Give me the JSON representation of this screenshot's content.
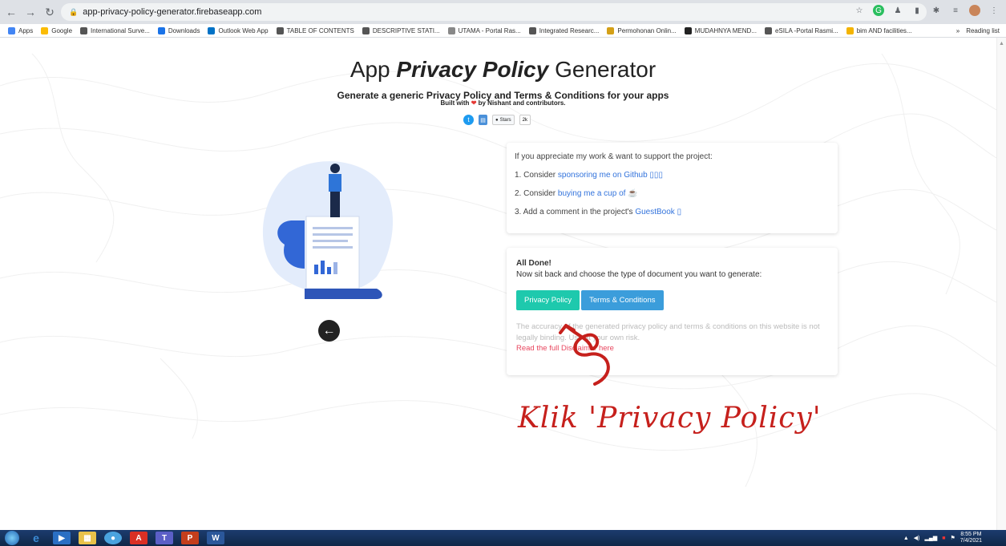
{
  "browser": {
    "url": "app-privacy-policy-generator.firebaseapp.com",
    "bookmarks": [
      {
        "label": "Apps",
        "color": "#4285f4"
      },
      {
        "label": "Google",
        "color": "#fbbc05"
      },
      {
        "label": "International Surve...",
        "color": "#555"
      },
      {
        "label": "Downloads",
        "color": "#1a73e8"
      },
      {
        "label": "Outlook Web App",
        "color": "#0072c6"
      },
      {
        "label": "TABLE OF CONTENTS",
        "color": "#555"
      },
      {
        "label": "DESCRIPTIVE STATI...",
        "color": "#555"
      },
      {
        "label": "UTAMA - Portal Ras...",
        "color": "#888"
      },
      {
        "label": "Integrated Researc...",
        "color": "#555"
      },
      {
        "label": "Permohonan Onlin...",
        "color": "#d4a017"
      },
      {
        "label": "MUDAHNYA MEND...",
        "color": "#222"
      },
      {
        "label": "eSILA -Portal Rasmi...",
        "color": "#555"
      },
      {
        "label": "bim AND facilities...",
        "color": "#f4b400"
      }
    ],
    "reading_list": "Reading list"
  },
  "page": {
    "title_pre": "App ",
    "title_em": "Privacy Policy",
    "title_post": " Generator",
    "subtitle": "Generate a generic Privacy Policy and Terms & Conditions for your apps",
    "built_pre": "Built with",
    "built_post": "by Nishant and contributors.",
    "github_star": "Stars",
    "github_count": "2k",
    "support": {
      "intro": "If you appreciate my work & want to support the project:",
      "item1_pre": "1. Consider ",
      "item1_link": "sponsoring me on Github ▯▯▯",
      "item2_pre": "2. Consider ",
      "item2_link": "buying me a cup of ☕",
      "item3_pre": "3. Add a comment in the project's ",
      "item3_link": "GuestBook ▯"
    },
    "done": {
      "heading": "All Done!",
      "text": "Now sit back and choose the type of document you want to generate:",
      "btn_privacy": "Privacy Policy",
      "btn_terms": "Terms & Conditions",
      "disclaimer": "The accuracy of the generated privacy policy and terms & conditions on this website is not legally binding. Use at your own risk.",
      "disclaimer_link": "Read the full Disclaimer here"
    },
    "annotation": "Klik 'Privacy Policy'"
  },
  "taskbar": {
    "time": "8:55 PM",
    "date": "7/4/2021"
  }
}
